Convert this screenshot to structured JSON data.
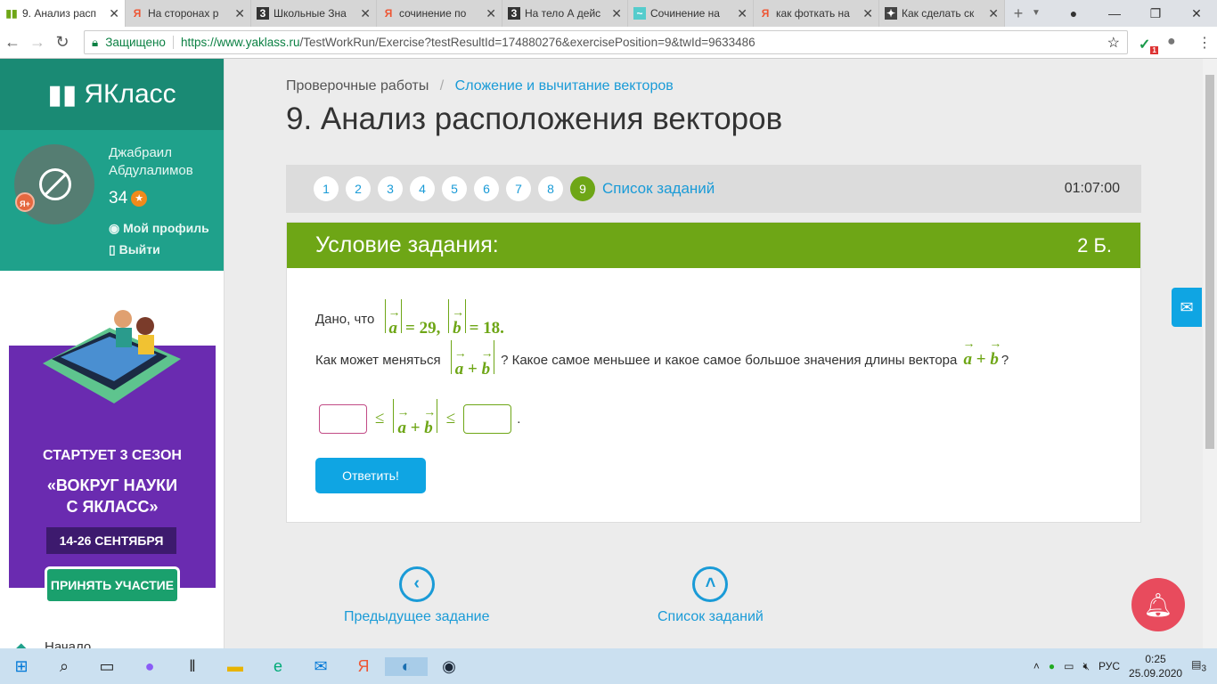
{
  "browser": {
    "tabs": [
      {
        "title": "9. Анализ расп",
        "icon": "yaklass-icon",
        "active": true
      },
      {
        "title": "На сторонах р",
        "icon": "yandex-icon"
      },
      {
        "title": "Школьные Зна",
        "icon": "znanija-icon"
      },
      {
        "title": "сочинение по",
        "icon": "yandex-icon"
      },
      {
        "title": "На тело А дейс",
        "icon": "znanija-icon"
      },
      {
        "title": "Сочинение на",
        "icon": "site-icon"
      },
      {
        "title": "как фоткать на",
        "icon": "yandex-icon"
      },
      {
        "title": "Как сделать ск",
        "icon": "site-icon"
      }
    ],
    "security_label": "Защищено",
    "url_host": "https://www.yaklass.ru",
    "url_path": "/TestWorkRun/Exercise?testResultId=174880276&exercisePosition=9&twId=9633486",
    "ext_badge": "1"
  },
  "sidebar": {
    "logo": "ЯКласс",
    "user_name_1": "Джабраил",
    "user_name_2": "Абдулалимов",
    "points": "34",
    "badge": "Я+",
    "profile": "Мой профиль",
    "logout": "Выйти",
    "promo": {
      "line1": "СТАРТУЕТ  3 СЕЗОН",
      "line2": "«ВОКРУГ НАУКИ",
      "line3": "С ЯКЛАСС»",
      "dates": "14-26 СЕНТЯБРЯ",
      "button": "ПРИНЯТЬ УЧАСТИЕ"
    },
    "home": "Начало"
  },
  "main": {
    "breadcrumb_root": "Проверочные работы",
    "breadcrumb_sep": "/",
    "breadcrumb_link": "Сложение и вычитание векторов",
    "title": "9. Анализ расположения векторов",
    "pages": [
      "1",
      "2",
      "3",
      "4",
      "5",
      "6",
      "7",
      "8",
      "9"
    ],
    "current_page": "9",
    "task_list": "Список заданий",
    "timer": "01:07:00",
    "task_header": "Условие задания:",
    "task_points": "2 Б.",
    "given_prefix": "Дано, что",
    "a": "a",
    "b": "b",
    "eq_a": "= 29,",
    "eq_b": "= 18.",
    "question_prefix": "Как может меняться",
    "plus": "+",
    "question_mid": "? Какое самое меньшее и какое самое большое значения длины вектора",
    "question_end": "?",
    "leq": "≤",
    "dot": ".",
    "min_value": "",
    "max_value": "",
    "answer_button": "Ответить!",
    "prev_task": "Предыдущее задание",
    "list_tasks": "Список заданий"
  },
  "taskbar": {
    "lang": "РУС",
    "time": "0:25",
    "date": "25.09.2020",
    "notifications": "3"
  },
  "colors": {
    "green": "#6ea616",
    "teal": "#1fa18b",
    "blue": "#1a9bd7"
  }
}
